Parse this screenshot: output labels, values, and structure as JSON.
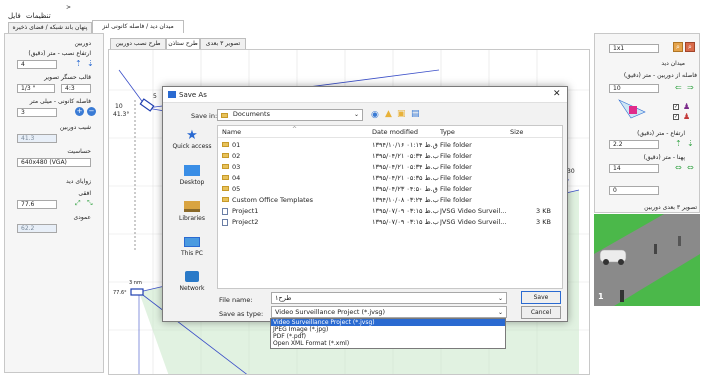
{
  "menu": {
    "settings": "تنظیمات",
    "file": "فایل",
    "arrow": "<"
  },
  "top_tabs": [
    "میدان دید / فاصله کانونی لنز",
    "پنهان باند شبکه / فضای ذخیره"
  ],
  "left_panel": {
    "camera_group": "دوربین",
    "install_height_label": "ارتفاع نصب - متر (دقیق)",
    "install_height_value": "4",
    "sensor_label": "قالب حسگر تصویر",
    "sensor_value": "1/3 \"",
    "aspect_value": "4:3",
    "focal_label": "فاصله کانونی - میلی متر",
    "focal_value": "3",
    "tilt_label": "شیب دوربین",
    "tilt_value": "41.3",
    "resolution_label": "حساسیت",
    "resolution_value": "640x480 (VGA)",
    "view_angle_group": "زوایای دید",
    "horizontal_label": "افقی",
    "horizontal_value": "77.6",
    "vertical_label": "عمودی",
    "vertical_value": "62.2"
  },
  "center_tabs": [
    "طرح نصب دوربین",
    "طرح ستاذن",
    "تصویر ۳ بعدی"
  ],
  "diagram": {
    "label_5": "5",
    "label_10": "10",
    "label_angle": "41.3°",
    "label_30": "30",
    "label_3nm": "3 nm",
    "label_776": "77.6°"
  },
  "right_panel": {
    "scale_value": "1x1",
    "fov_group": "میدان دید",
    "distance_label": "فاصله از دوربین - متر (دقیق)",
    "distance_value": "10",
    "height_label": "ارتفاع - متر (دقیق)",
    "height_value": "2.2",
    "width_label": "پهنا - متر (دقیق)",
    "width_value": "14",
    "zero_value": "0",
    "preview_title": "تصویر ۳ بعدی دوربین",
    "preview_number": "1"
  },
  "dialog": {
    "title": "Save As",
    "save_in_label": "Save in:",
    "save_in_value": "Documents",
    "columns": {
      "name": "Name",
      "date": "Date modified",
      "type": "Type",
      "size": "Size"
    },
    "places": [
      "Quick access",
      "Desktop",
      "Libraries",
      "This PC",
      "Network"
    ],
    "files": [
      {
        "name": "01",
        "date": "۱۳۹۴/۱۰/۱۶ ق.ظ ۰۱:۱۴",
        "type": "File folder",
        "size": "",
        "kind": "folder"
      },
      {
        "name": "02",
        "date": "۱۳۹۵/۰۴/۲۱ ب.ظ ۰۵:۳۴",
        "type": "File folder",
        "size": "",
        "kind": "folder"
      },
      {
        "name": "03",
        "date": "۱۳۹۵/۰۴/۲۱ ب.ظ ۰۵:۳۴",
        "type": "File folder",
        "size": "",
        "kind": "folder"
      },
      {
        "name": "04",
        "date": "۱۳۹۵/۰۴/۲۱ ب.ظ ۰۵:۳۵",
        "type": "File folder",
        "size": "",
        "kind": "folder"
      },
      {
        "name": "05",
        "date": "۱۳۹۵/۰۴/۲۳ ق.ظ ۰۴:۵۰",
        "type": "File folder",
        "size": "",
        "kind": "folder"
      },
      {
        "name": "Custom Office Templates",
        "date": "۱۳۹۴/۱۰/۰۸ ب.ظ ۰۳:۲۴",
        "type": "File folder",
        "size": "",
        "kind": "folder"
      },
      {
        "name": "Project1",
        "date": "۱۳۹۵/۰۷/۰۹ ب.ظ ۰۳:۱۵",
        "type": "JVSG Video Surveil...",
        "size": "3 KB",
        "kind": "file"
      },
      {
        "name": "Project2",
        "date": "۱۳۹۵/۰۷/۰۹ ب.ظ ۰۳:۱۵",
        "type": "JVSG Video Surveil...",
        "size": "3 KB",
        "kind": "file"
      }
    ],
    "filename_label": "File name:",
    "filename_value": "طرح۱",
    "savetype_label": "Save as type:",
    "savetype_value": "Video Surveillance Project (*.jvsg)",
    "savetype_options": [
      "Video Surveillance Project (*.jvsg)",
      "JPEG Image (*.jpg)",
      "PDF (*.pdf)",
      "Open XML Format (*.xml)"
    ],
    "save_button": "Save",
    "cancel_button": "Cancel"
  }
}
